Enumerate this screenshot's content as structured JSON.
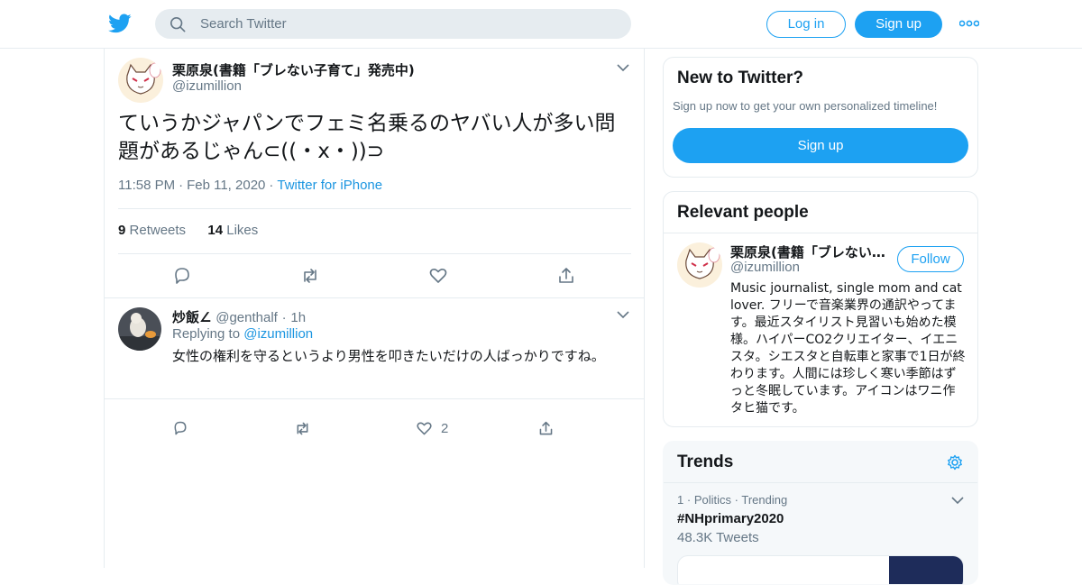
{
  "colors": {
    "accent": "#1da1f2",
    "link": "#1b95e0",
    "muted": "#657786",
    "border": "#e6ecf0"
  },
  "header": {
    "logo_icon": "twitter-bird-icon",
    "search_placeholder": "Search Twitter",
    "login_label": "Log in",
    "signup_label": "Sign up",
    "more_icon": "more-dots-icon"
  },
  "main_tweet": {
    "name": "栗原泉(書籍「ブレない子育て」発売中)",
    "handle": "@izumillion",
    "text": "ていうかジャパンでフェミ名乗るのヤバい人が多い問題があるじゃん⊂((・x・))⊃",
    "time": "11:58 PM",
    "date": "Feb 11, 2020",
    "source": "Twitter for iPhone",
    "retweets_count": "9",
    "retweets_label": "Retweets",
    "likes_count": "14",
    "likes_label": "Likes"
  },
  "reply": {
    "name": "炒飯∠",
    "handle": "@genthalf",
    "time": "1h",
    "replying_label": "Replying to",
    "replying_to": "@izumillion",
    "text": "女性の権利を守るというより男性を叩きたいだけの人ばっかりですね。",
    "like_count": "2"
  },
  "sidebar": {
    "new_title": "New to Twitter?",
    "new_sub": "Sign up now to get your own personalized timeline!",
    "new_signup": "Sign up",
    "relevant_title": "Relevant people",
    "person": {
      "name": "栗原泉(書籍「ブレない…",
      "handle": "@izumillion",
      "follow_label": "Follow",
      "bio": "Music journalist, single mom and cat lover. フリーで音楽業界の通訳やってます。最近スタイリスト見習いも始めた模様。ハイパーCO2クリエイター、イエニスタ。シエスタと自転車と家事で1日が終わります。人間には珍しく寒い季節はずっと冬眠しています。アイコンはワニ作タヒ猫です。"
    },
    "trends_title": "Trends",
    "trend": {
      "rank": "1",
      "category": "Politics",
      "status": "Trending",
      "tag": "#NHprimary2020",
      "count": "48.3K Tweets"
    }
  }
}
